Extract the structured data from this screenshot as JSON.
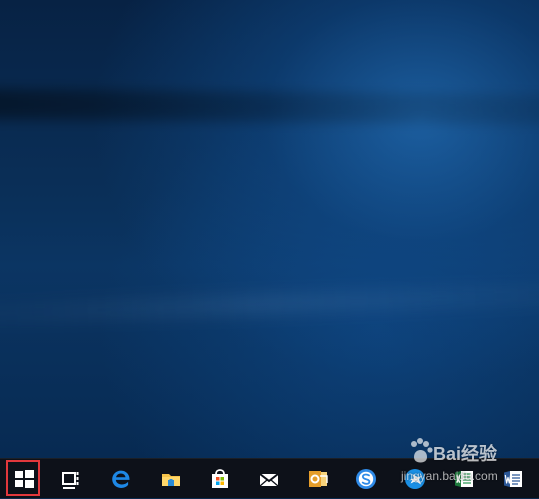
{
  "desktop": {
    "wallpaper": "Windows 10 hero blue",
    "colors": {
      "dark": "#072244",
      "mid": "#0b3563",
      "light": "#1f67ad"
    }
  },
  "taskbar": {
    "background": "#0d1119",
    "highlight_color": "#e2383c",
    "items": [
      {
        "icon": "windows-start-icon"
      },
      {
        "icon": "task-view-icon"
      },
      {
        "icon": "edge-icon"
      },
      {
        "icon": "file-explorer-icon"
      },
      {
        "icon": "store-icon"
      },
      {
        "icon": "mail-icon"
      },
      {
        "icon": "outlook-icon"
      },
      {
        "icon": "sogou-browser-icon"
      },
      {
        "icon": "bird-app-icon"
      },
      {
        "icon": "excel-icon"
      },
      {
        "icon": "word-icon"
      }
    ]
  },
  "watermark": {
    "main": "Bai经验",
    "sub": "jingyan.baidu.com"
  }
}
